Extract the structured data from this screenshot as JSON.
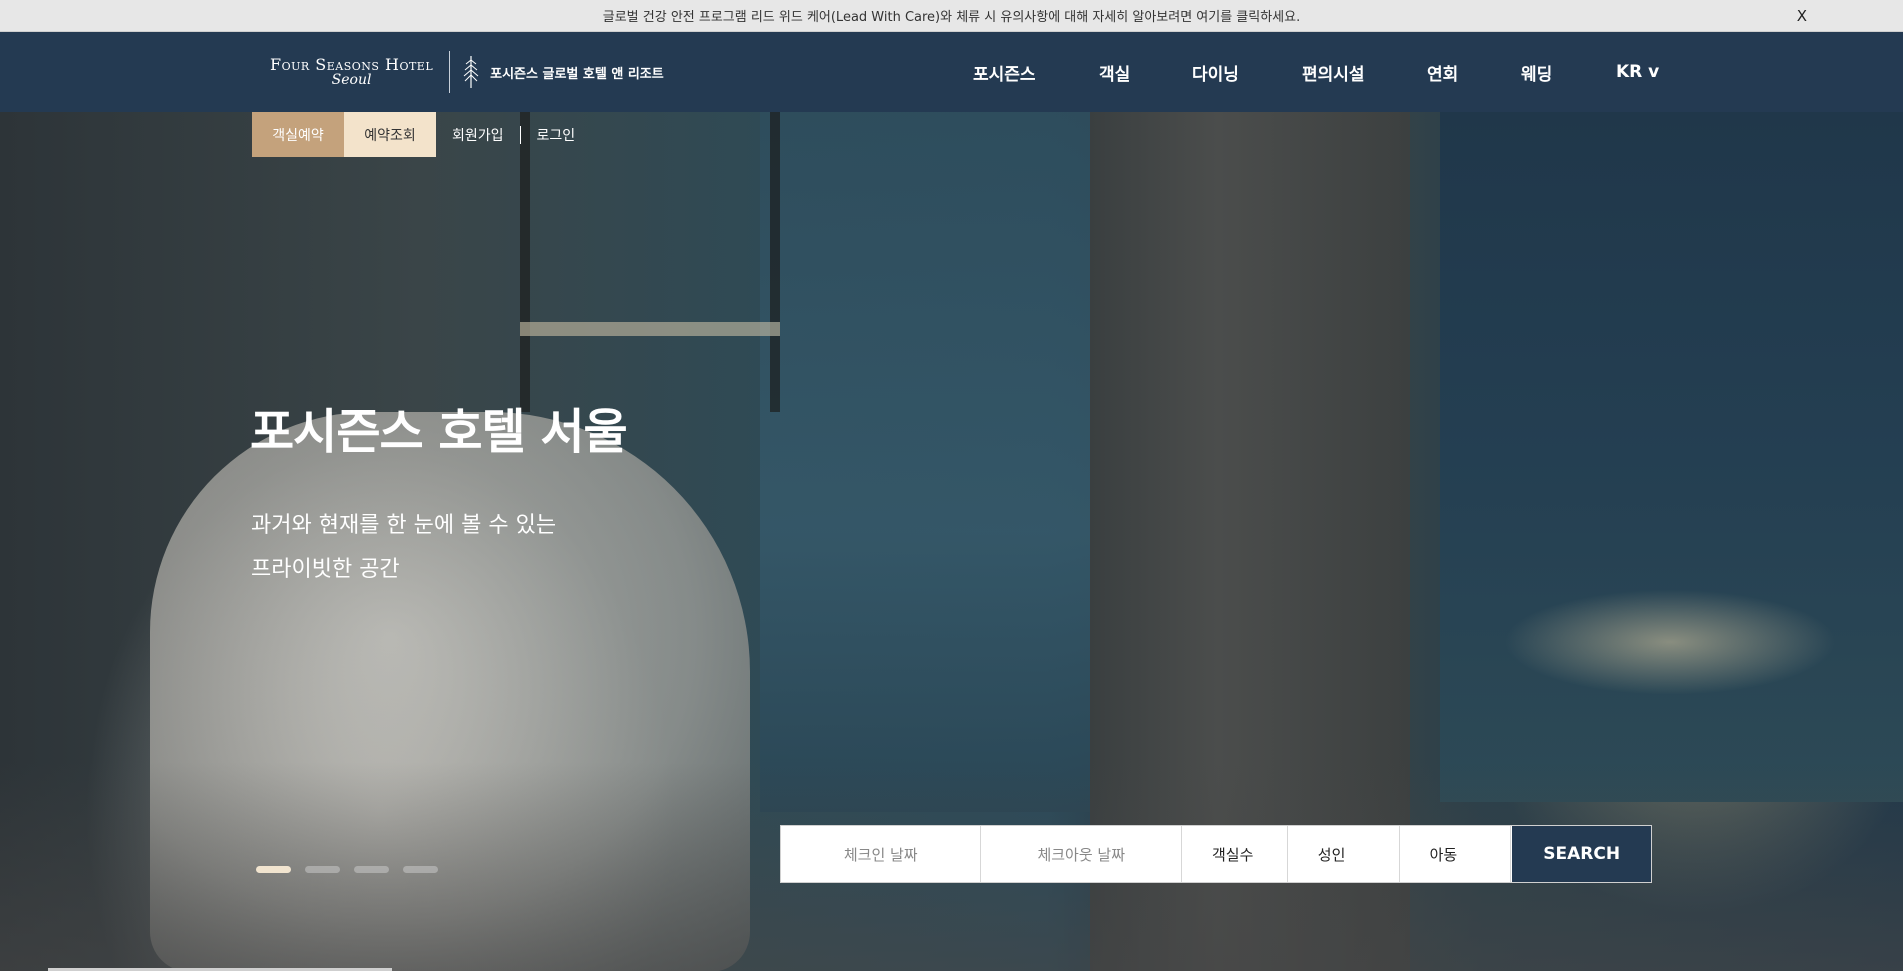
{
  "notice": {
    "text": "글로벌 건강 안전 프로그램 리드 위드 케어(Lead With Care)와 체류 시 유의사항에 대해 자세히 알아보려면 여기를 클릭하세요.",
    "close": "X"
  },
  "logo": {
    "line1": "Four Seasons Hotel",
    "line2": "Seoul",
    "tagline": "포시즌스 글로벌 호텔 앤 리조트"
  },
  "nav": {
    "items": [
      "포시즌스",
      "객실",
      "다이닝",
      "편의시설",
      "연회",
      "웨딩",
      "KR v"
    ]
  },
  "quick_links": {
    "reserve": "객실예약",
    "check": "예약조회",
    "signup": "회원가입",
    "login": "로그인"
  },
  "hero": {
    "title": "포시즌스 호텔 서울",
    "sub_line1": "과거와 현재를 한 눈에 볼 수 있는",
    "sub_line2": "프라이빗한 공간"
  },
  "slider": {
    "count": 4,
    "active": 1
  },
  "booking": {
    "checkin": "체크인 날짜",
    "checkout": "체크아웃 날짜",
    "rooms": "객실수",
    "adults": "성인",
    "children": "아동",
    "search": "SEARCH"
  },
  "colors": {
    "header_bg": "#243a52",
    "reserve_bg": "#c4a27c",
    "check_bg": "#f3e3cb",
    "notice_bg": "#e7e7e7"
  }
}
